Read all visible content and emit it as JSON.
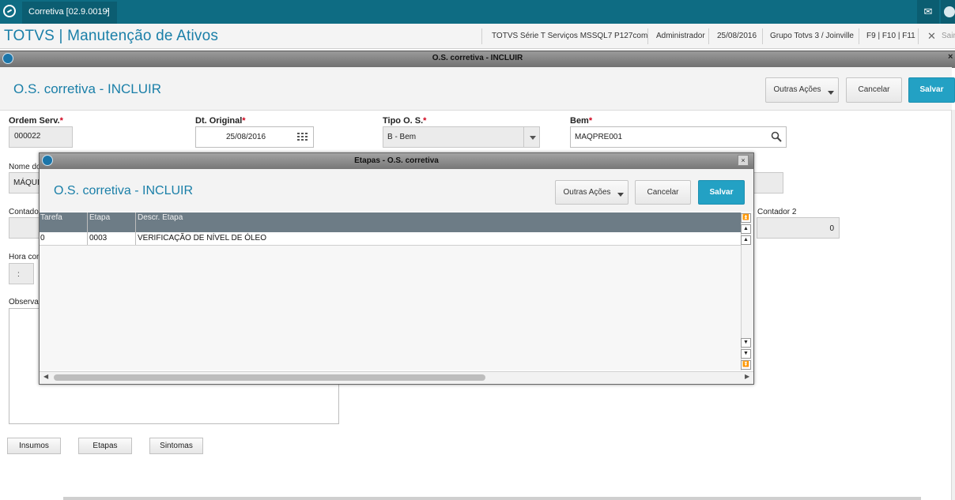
{
  "tabbar": {
    "tab_label": "Corretiva [02.9.0019]",
    "tab_close": "×"
  },
  "header": {
    "brand": "TOTVS | Manutenção de Ativos",
    "system": "TOTVS Série T Serviços MSSQL7 P127com",
    "user": "Administrador",
    "date": "25/08/2016",
    "company": "Grupo Totvs 3 / Joinville",
    "keys": "F9 | F10 | F11",
    "close": "✕",
    "exit": "Sair"
  },
  "window": {
    "bar_title": "O.S. corretiva - INCLUIR",
    "title": "O.S. corretiva - INCLUIR",
    "btn_outras": "Outras Ações",
    "btn_cancelar": "Cancelar",
    "btn_salvar": "Salvar",
    "close": "×"
  },
  "form": {
    "ordem_label": "Ordem Serv.",
    "ordem_value": "000022",
    "dtorig_label": "Dt. Original",
    "dtorig_value": "25/08/2016",
    "tipo_label": "Tipo O. S.",
    "tipo_value": "B - Bem",
    "bem_label": "Bem",
    "bem_value": "MAQPRE001",
    "required_mark": "*",
    "nome_label": "Nome do",
    "nome_value": "MÁQUIN",
    "contador_label": "Contador",
    "contador2_label": "Contador 2",
    "contador2_value": "0",
    "hora_label": "Hora con",
    "hora_value": ":",
    "obs_label": "Observa"
  },
  "footer_buttons": {
    "insumos": "Insumos",
    "etapas": "Etapas",
    "sintomas": "Sintomas"
  },
  "dialog": {
    "bar_title": "Etapas - O.S. corretiva",
    "title": "O.S. corretiva - INCLUIR",
    "btn_outras": "Outras Ações",
    "btn_cancelar": "Cancelar",
    "btn_salvar": "Salvar",
    "close": "×",
    "columns": [
      "Tarefa",
      "Etapa",
      "Descr. Etapa"
    ],
    "rows": [
      {
        "tarefa": "0",
        "etapa": "0003",
        "descr": "VERIFICAÇÃO DE NÍVEL DE ÓLEO"
      }
    ]
  },
  "icons": {
    "calendar": "calendar-icon",
    "search": "search-icon",
    "dropdown": "chevron-down-icon",
    "mail": "mail-icon",
    "scroll_first": "scroll-top-icon",
    "scroll_pageup": "scroll-page-up-icon",
    "scroll_up": "scroll-up-icon",
    "scroll_down": "scroll-down-icon",
    "scroll_pagedown": "scroll-page-down-icon",
    "scroll_last": "scroll-bottom-icon"
  },
  "colors": {
    "brand": "#1a7fa8",
    "tabbar": "#0e6c83",
    "primary_button": "#23a1c4",
    "grid_header": "#6d7c86",
    "required": "#d0021b"
  }
}
